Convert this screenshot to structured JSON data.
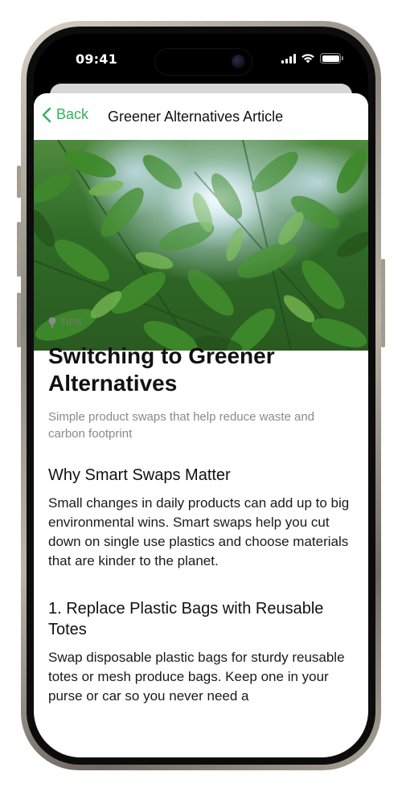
{
  "status_bar": {
    "time": "09:41",
    "icons": [
      "signal-icon",
      "wifi-icon",
      "battery-icon"
    ]
  },
  "nav": {
    "back_label": "Back",
    "title": "Greener Alternatives Article",
    "accent_color": "#2fb35a"
  },
  "hero": {
    "description": "Green leafy plants against a bright sky"
  },
  "article": {
    "tag_icon": "lightbulb-icon",
    "tag": "TIPS",
    "title": "Switching to Greener Alternatives",
    "subtitle": "Simple product swaps that help reduce waste and carbon footprint",
    "sections": [
      {
        "heading": "Why Smart Swaps Matter",
        "body": "Small changes in daily products can add up to big environmental wins. Smart swaps help you cut down on single use plastics and choose materials that are kinder to the planet."
      },
      {
        "heading": "1. Replace Plastic Bags with Reusable Totes",
        "body": "Swap disposable plastic bags for sturdy reusable totes or mesh produce bags. Keep one in your purse or car so you never need a"
      }
    ]
  }
}
